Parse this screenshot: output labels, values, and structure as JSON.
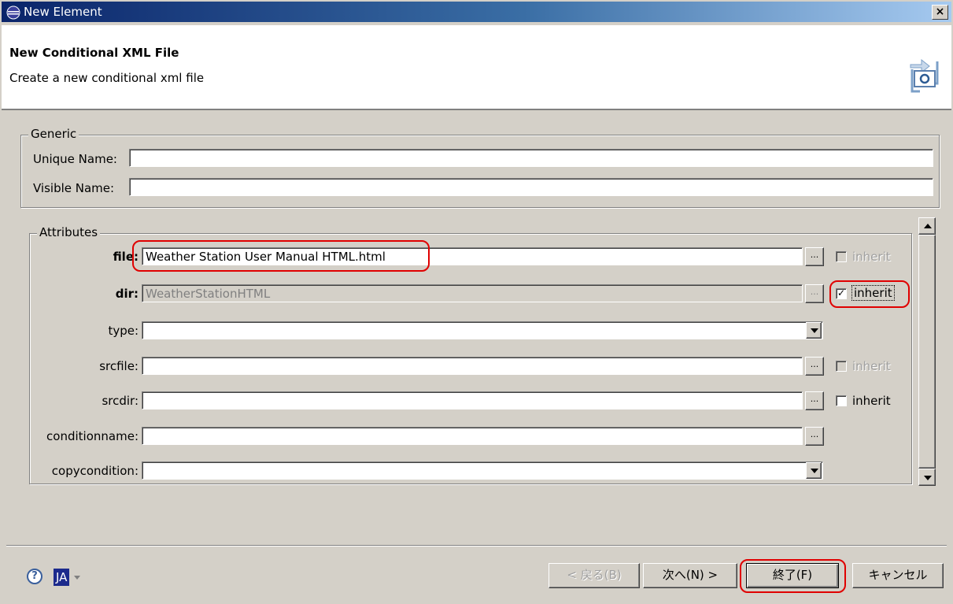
{
  "window": {
    "title": "New Element",
    "close_label": "×"
  },
  "header": {
    "title": "New Conditional XML File",
    "description": "Create a new conditional xml file"
  },
  "generic": {
    "legend": "Generic",
    "unique_name_label": "Unique Name:",
    "unique_name_value": "",
    "visible_name_label": "Visible Name:",
    "visible_name_value": ""
  },
  "attributes": {
    "legend": "Attributes",
    "browse_label": "...",
    "file": {
      "label": "file:",
      "value": "Weather Station User Manual HTML.html",
      "inherit_label": "inherit",
      "inherit_checked": false
    },
    "dir": {
      "label": "dir:",
      "value": "WeatherStationHTML",
      "inherit_label": "inherit",
      "inherit_checked": true
    },
    "type": {
      "label": "type:",
      "value": ""
    },
    "srcfile": {
      "label": "srcfile:",
      "value": "",
      "inherit_label": "inherit",
      "inherit_checked": false
    },
    "srcdir": {
      "label": "srcdir:",
      "value": "",
      "inherit_label": "inherit",
      "inherit_checked": false
    },
    "conditionname": {
      "label": "conditionname:",
      "value": ""
    },
    "copycondition": {
      "label": "copycondition:",
      "value": ""
    }
  },
  "footer": {
    "help_icon": "?",
    "lang_badge": "JA",
    "back_button": "< 戻る(B)",
    "next_button": "次へ(N) >",
    "finish_button": "終了(F)",
    "cancel_button": "キャンセル"
  },
  "colors": {
    "titlebar_start": "#0a246a",
    "titlebar_end": "#a6caf0",
    "highlight_red": "#e00000",
    "dialog_bg": "#d4d0c8"
  }
}
